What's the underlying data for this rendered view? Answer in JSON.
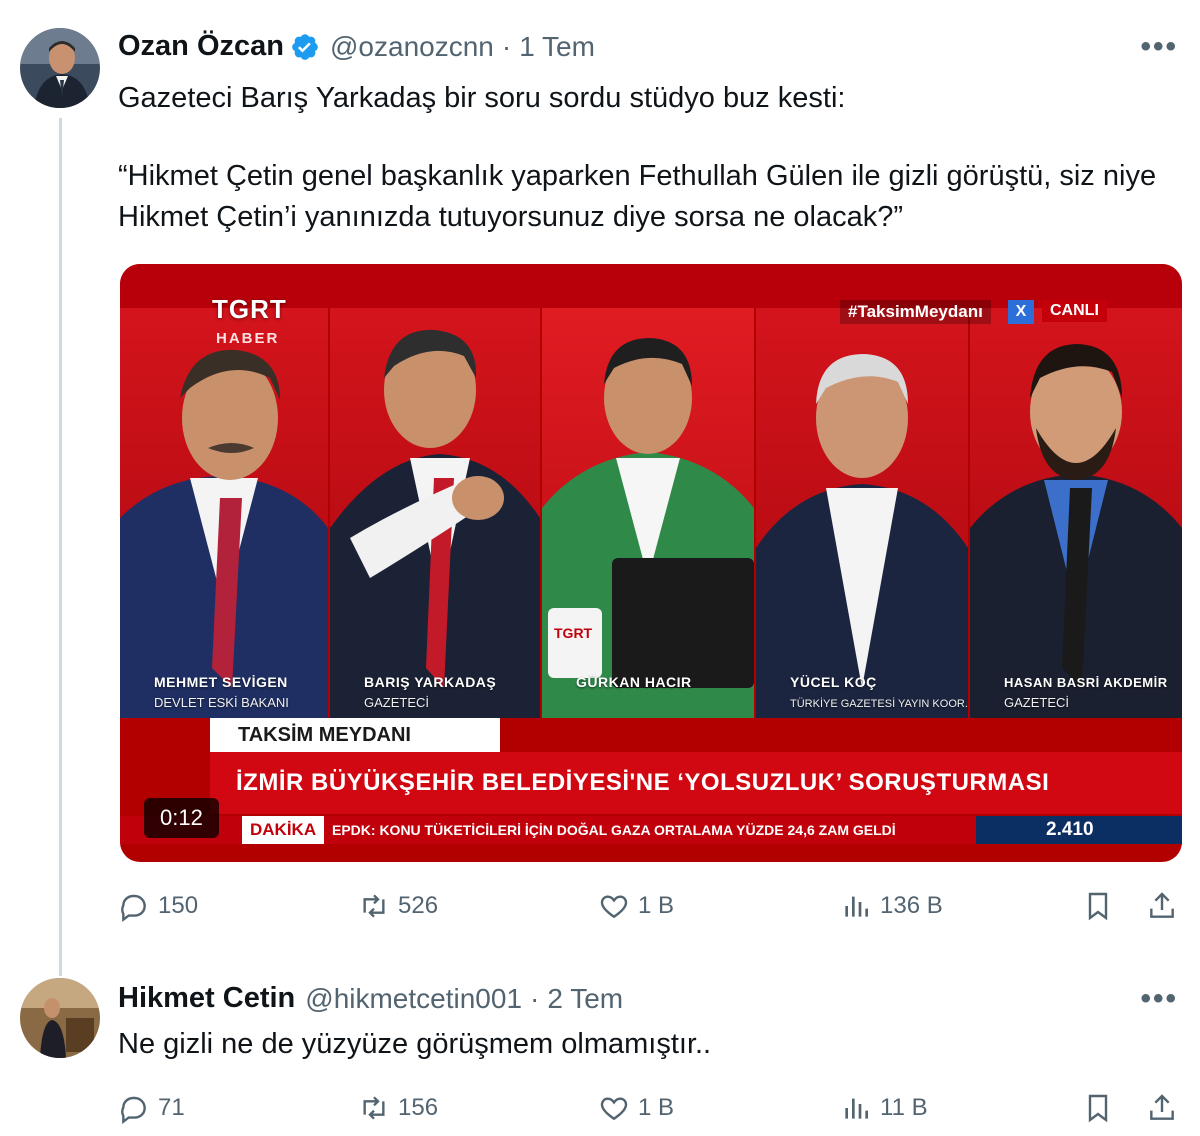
{
  "colors": {
    "verified": "#1d9bf0",
    "text": "#0f1419",
    "muted": "#536471"
  },
  "tweet": {
    "author_name": "Ozan Özcan",
    "handle": "@ozanozcnn",
    "time": "1 Tem",
    "text_line1": "Gazeteci Barış Yarkadaş bir soru sordu stüdyo buz kesti:",
    "text_quote": "“Hikmet Çetin genel başkanlık yaparken Fethullah Gülen ile gizli görüştü, siz niye Hikmet Çetin’i yanınızda tutuyorsunuz diye sorsa ne olacak?”",
    "video": {
      "channel": "TGRT",
      "channel_sub": "HABER",
      "hashtag": "#TaksimMeydanı",
      "live": "CANLI",
      "guests": [
        {
          "name": "MEHMET SEVİGEN",
          "role": "DEVLET ESKİ BAKANI"
        },
        {
          "name": "BARIŞ YARKADAŞ",
          "role": "GAZETECİ"
        },
        {
          "name": "GÜRKAN HACIR",
          "role": ""
        },
        {
          "name": "YÜCEL KOÇ",
          "role": "TÜRKİYE GAZETESİ YAYIN KOOR."
        },
        {
          "name": "HASAN BASRİ AKDEMİR",
          "role": "GAZETECİ"
        }
      ],
      "program": "TAKSİM MEYDANI",
      "headline": "İZMİR BÜYÜKŞEHİR BELEDİYESİ'NE ‘YOLSUZLUK’ SORUŞTURMASI",
      "ticker_label": "DAKİKA",
      "ticker_text": "EPDK: KONU TÜKETİCİLERİ İÇİN DOĞAL GAZA ORTALAMA YÜZDE 24,6 ZAM GELDİ",
      "ticker_value": "2.410",
      "timecode": "0:12"
    },
    "stats": {
      "replies": "150",
      "reposts": "526",
      "likes": "1 B",
      "views": "136 B"
    }
  },
  "reply": {
    "author_name": "Hikmet Cetin",
    "handle": "@hikmetcetin001",
    "time": "2 Tem",
    "text": "Ne gizli ne de yüzyüze görüşmem olmamıştır..",
    "stats": {
      "replies": "71",
      "reposts": "156",
      "likes": "1 B",
      "views": "11 B"
    }
  },
  "icons": [
    "reply-icon",
    "repost-icon",
    "like-icon",
    "views-icon",
    "bookmark-icon",
    "share-icon",
    "more-icon",
    "verified-badge-icon"
  ]
}
